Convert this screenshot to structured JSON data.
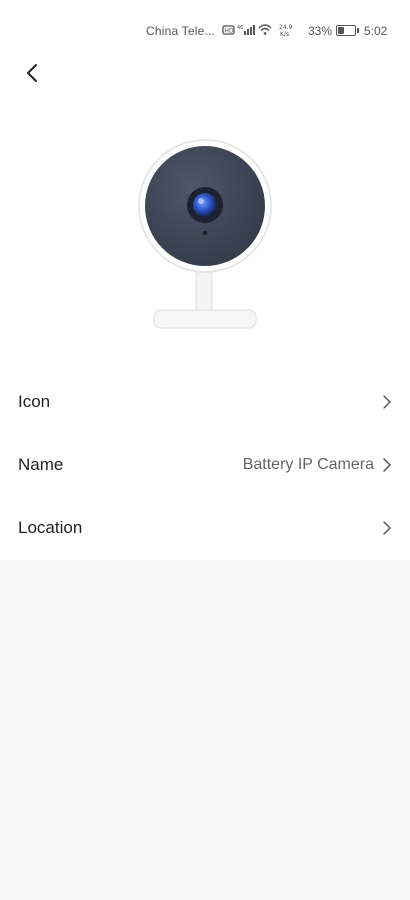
{
  "status_bar": {
    "carrier": "China Tele...",
    "network_speed": "24.9 K/s",
    "battery_percent": "33%",
    "time": "5:02"
  },
  "header": {
    "back_icon": "chevron-left-icon"
  },
  "device": {
    "illustration_icon": "ip-camera-icon"
  },
  "settings": {
    "rows": [
      {
        "label": "Icon",
        "value": ""
      },
      {
        "label": "Name",
        "value": "Battery IP Camera"
      },
      {
        "label": "Location",
        "value": ""
      }
    ]
  },
  "colors": {
    "background": "#f7f7f7",
    "card": "#ffffff",
    "camera_face": "#3d4556",
    "lens": "#2f5fd0"
  }
}
